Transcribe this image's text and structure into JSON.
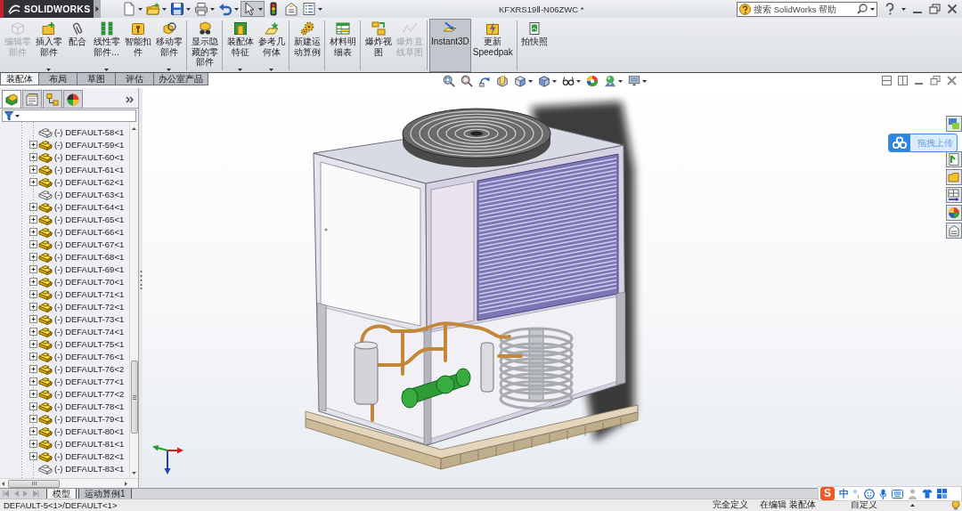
{
  "title_bar": {
    "logo": "SOLIDWORKS",
    "quick_access": [
      {
        "menu": true,
        "selected": false
      },
      {
        "menu": true,
        "selected": false
      },
      {
        "menu": true,
        "selected": false
      },
      {
        "menu": true,
        "selected": false
      },
      {
        "menu": true,
        "selected": false
      },
      {
        "menu": true,
        "selected": true
      },
      {
        "menu": false,
        "selected": false
      },
      {
        "menu": false,
        "selected": false
      },
      {
        "menu": true,
        "selected": false
      }
    ],
    "document_title": "KFXRS19Ⅱ-N06ZWC *",
    "search": {
      "placeholder": "搜索 SolidWorks 帮助"
    }
  },
  "command_groups": [
    [
      {
        "label": "编辑零部件",
        "disabled": true,
        "menu": false,
        "on": false
      },
      {
        "label": "插入零部件",
        "disabled": false,
        "menu": true,
        "on": false
      },
      {
        "label": "配合",
        "disabled": false,
        "menu": false,
        "on": false
      },
      {
        "label": "线性零部件...",
        "disabled": false,
        "menu": true,
        "on": false
      },
      {
        "label": "智能扣件",
        "disabled": false,
        "menu": false,
        "on": false
      },
      {
        "label": "移动零部件",
        "disabled": false,
        "menu": true,
        "on": false
      }
    ],
    [
      {
        "label": "显示隐藏的零部件",
        "disabled": false,
        "menu": false,
        "on": false
      }
    ],
    [
      {
        "label": "装配体特征",
        "disabled": false,
        "menu": true,
        "on": false
      },
      {
        "label": "参考几何体",
        "disabled": false,
        "menu": true,
        "on": false
      }
    ],
    [
      {
        "label": "新建运动算例",
        "disabled": false,
        "menu": false,
        "on": false
      }
    ],
    [
      {
        "label": "材料明细表",
        "disabled": false,
        "menu": false,
        "on": false
      }
    ],
    [
      {
        "label": "爆炸视图",
        "disabled": false,
        "menu": false,
        "on": false
      },
      {
        "label": "爆炸直线草图",
        "disabled": true,
        "menu": false,
        "on": false
      }
    ],
    [
      {
        "label": "Instant3D",
        "disabled": false,
        "menu": false,
        "on": true
      },
      {
        "label": "更新Speedpak",
        "disabled": false,
        "menu": false,
        "on": false
      }
    ],
    [
      {
        "label": "拍快照",
        "disabled": false,
        "menu": false,
        "on": false
      }
    ]
  ],
  "tabs": [
    {
      "label": "装配体",
      "selected": true
    },
    {
      "label": "布局",
      "selected": false
    },
    {
      "label": "草图",
      "selected": false
    },
    {
      "label": "评估",
      "selected": false
    },
    {
      "label": "办公室产品",
      "selected": false
    }
  ],
  "view_toolbar": [
    {
      "menu": false
    },
    {
      "menu": false
    },
    {
      "menu": false
    },
    {
      "menu": false
    },
    {
      "menu": true
    },
    {
      "menu": true
    },
    {
      "menu": true
    },
    {
      "menu": false
    },
    {
      "menu": true
    },
    {
      "menu": true
    }
  ],
  "feature_manager": {
    "panel_tabs": [
      {
        "selected": true
      },
      {
        "selected": false
      },
      {
        "selected": false
      },
      {
        "selected": false
      }
    ],
    "tree": [
      {
        "label": "(-) DEFAULT-58<1",
        "kind": "hidden"
      },
      {
        "label": "(-) DEFAULT-59<1",
        "kind": "assembly"
      },
      {
        "label": "(-) DEFAULT-60<1",
        "kind": "assembly"
      },
      {
        "label": "(-) DEFAULT-61<1",
        "kind": "assembly"
      },
      {
        "label": "(-) DEFAULT-62<1",
        "kind": "assembly"
      },
      {
        "label": "(-) DEFAULT-63<1",
        "kind": "hidden"
      },
      {
        "label": "(-) DEFAULT-64<1",
        "kind": "assembly"
      },
      {
        "label": "(-) DEFAULT-65<1",
        "kind": "assembly"
      },
      {
        "label": "(-) DEFAULT-66<1",
        "kind": "assembly"
      },
      {
        "label": "(-) DEFAULT-67<1",
        "kind": "assembly"
      },
      {
        "label": "(-) DEFAULT-68<1",
        "kind": "assembly"
      },
      {
        "label": "(-) DEFAULT-69<1",
        "kind": "assembly"
      },
      {
        "label": "(-) DEFAULT-70<1",
        "kind": "assembly"
      },
      {
        "label": "(-) DEFAULT-71<1",
        "kind": "assembly"
      },
      {
        "label": "(-) DEFAULT-72<1",
        "kind": "assembly"
      },
      {
        "label": "(-) DEFAULT-73<1",
        "kind": "assembly"
      },
      {
        "label": "(-) DEFAULT-74<1",
        "kind": "assembly"
      },
      {
        "label": "(-) DEFAULT-75<1",
        "kind": "assembly"
      },
      {
        "label": "(-) DEFAULT-76<1",
        "kind": "assembly"
      },
      {
        "label": "(-) DEFAULT-76<2",
        "kind": "assembly"
      },
      {
        "label": "(-) DEFAULT-77<1",
        "kind": "assembly"
      },
      {
        "label": "(-) DEFAULT-77<2",
        "kind": "assembly"
      },
      {
        "label": "(-) DEFAULT-78<1",
        "kind": "assembly"
      },
      {
        "label": "(-) DEFAULT-79<1",
        "kind": "assembly"
      },
      {
        "label": "(-) DEFAULT-80<1",
        "kind": "assembly"
      },
      {
        "label": "(-) DEFAULT-81<1",
        "kind": "assembly"
      },
      {
        "label": "(-) DEFAULT-82<1",
        "kind": "assembly"
      },
      {
        "label": "(-) DEFAULT-83<1",
        "kind": "hidden"
      }
    ],
    "bottom_tabs": [
      {
        "label": "模型",
        "selected": true
      },
      {
        "label": "运动算例1",
        "selected": false
      }
    ]
  },
  "upload_button": {
    "label": "拖拽上传"
  },
  "status_bar": {
    "path": "DEFAULT-5<1>/DEFAULT<1>",
    "state": "完全定义",
    "mode": "在编辑 装配体",
    "units": "自定义"
  },
  "ime_toolbar": {
    "logo": "S",
    "mode": "中",
    "punctuation": "°,"
  }
}
